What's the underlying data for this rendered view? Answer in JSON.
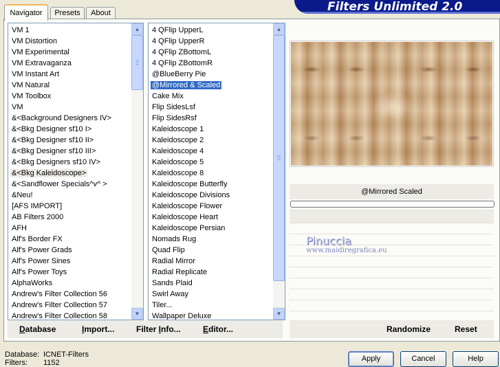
{
  "banner": {
    "title": "Filters Unlimited 2.0"
  },
  "tabs": [
    {
      "label": "Navigator"
    },
    {
      "label": "Presets"
    },
    {
      "label": "About"
    }
  ],
  "categories": {
    "items": [
      "VM 1",
      "VM Distortion",
      "VM Experimental",
      "VM Extravaganza",
      "VM Instant Art",
      "VM Natural",
      "VM Toolbox",
      "VM",
      "&<Background Designers IV>",
      "&<Bkg Designer sf10 I>",
      "&<Bkg Designer sf10 II>",
      "&<Bkg Designer sf10 III>",
      "&<Bkg Designers sf10 IV>",
      "&<Bkg Kaleidoscope>",
      "&<Sandflower Specials^v^ >",
      "&Neu!",
      "[AFS IMPORT]",
      "AB Filters 2000",
      "AFH",
      "Alf's Border FX",
      "Alf's Power Grads",
      "Alf's Power Sines",
      "Alf's Power Toys",
      "AlphaWorks",
      "Andrew's Filter Collection 56",
      "Andrew's Filter Collection 57",
      "Andrew's Filter Collection 58"
    ],
    "highlighted_index": 13
  },
  "filters": {
    "items": [
      "4 QFlip UpperL",
      "4 QFlip UpperR",
      "4 QFlip ZBottomL",
      "4 QFlip ZBottomR",
      "@BlueBerry Pie",
      "@Mirrored & Scaled",
      "Cake Mix",
      "Flip SidesLsf",
      "Flip SidesRsf",
      "Kaleidoscope 1",
      "Kaleidoscope 2",
      "Kaleidoscope 4",
      "Kaleidoscope 5",
      "Kaleidoscope 8",
      "Kaleidoscope Butterfly",
      "Kaleidoscope Divisions",
      "Kaleidoscope Flower",
      "Kaleidoscope Heart",
      "Kaleidoscope Persian",
      "Nomads Rug",
      "Quad Flip",
      "Radial Mirror",
      "Radial Replicate",
      "Sands Plaid",
      "Swirl Away",
      "Tiler...",
      "Wallpaper Deluxe"
    ],
    "selected_index": 5
  },
  "preview": {
    "filter_name": "@Mirrored  Scaled"
  },
  "watermark": {
    "line1": "Pinuccia",
    "line2": "www.maidiregrafica.eu"
  },
  "toolbar": {
    "database": {
      "u": "D",
      "rest": "atabase"
    },
    "import": {
      "pre": "",
      "u": "I",
      "rest": "mport..."
    },
    "filter_info": {
      "pre": "Filter ",
      "u": "I",
      "rest": "nfo..."
    },
    "editor": {
      "u": "E",
      "rest": "ditor..."
    },
    "randomize": "Randomize",
    "reset": "Reset"
  },
  "status": {
    "database_label": "Database:",
    "database_value": "ICNET-Filters",
    "filters_label": "Filters:",
    "filters_value": "1152"
  },
  "buttons": {
    "apply": "Apply",
    "cancel": "Cancel",
    "help": "Help"
  },
  "colors": {
    "selection": "#316ac5",
    "banner": "#0a1a8a",
    "tab_active_accent": "#f3b35b"
  }
}
